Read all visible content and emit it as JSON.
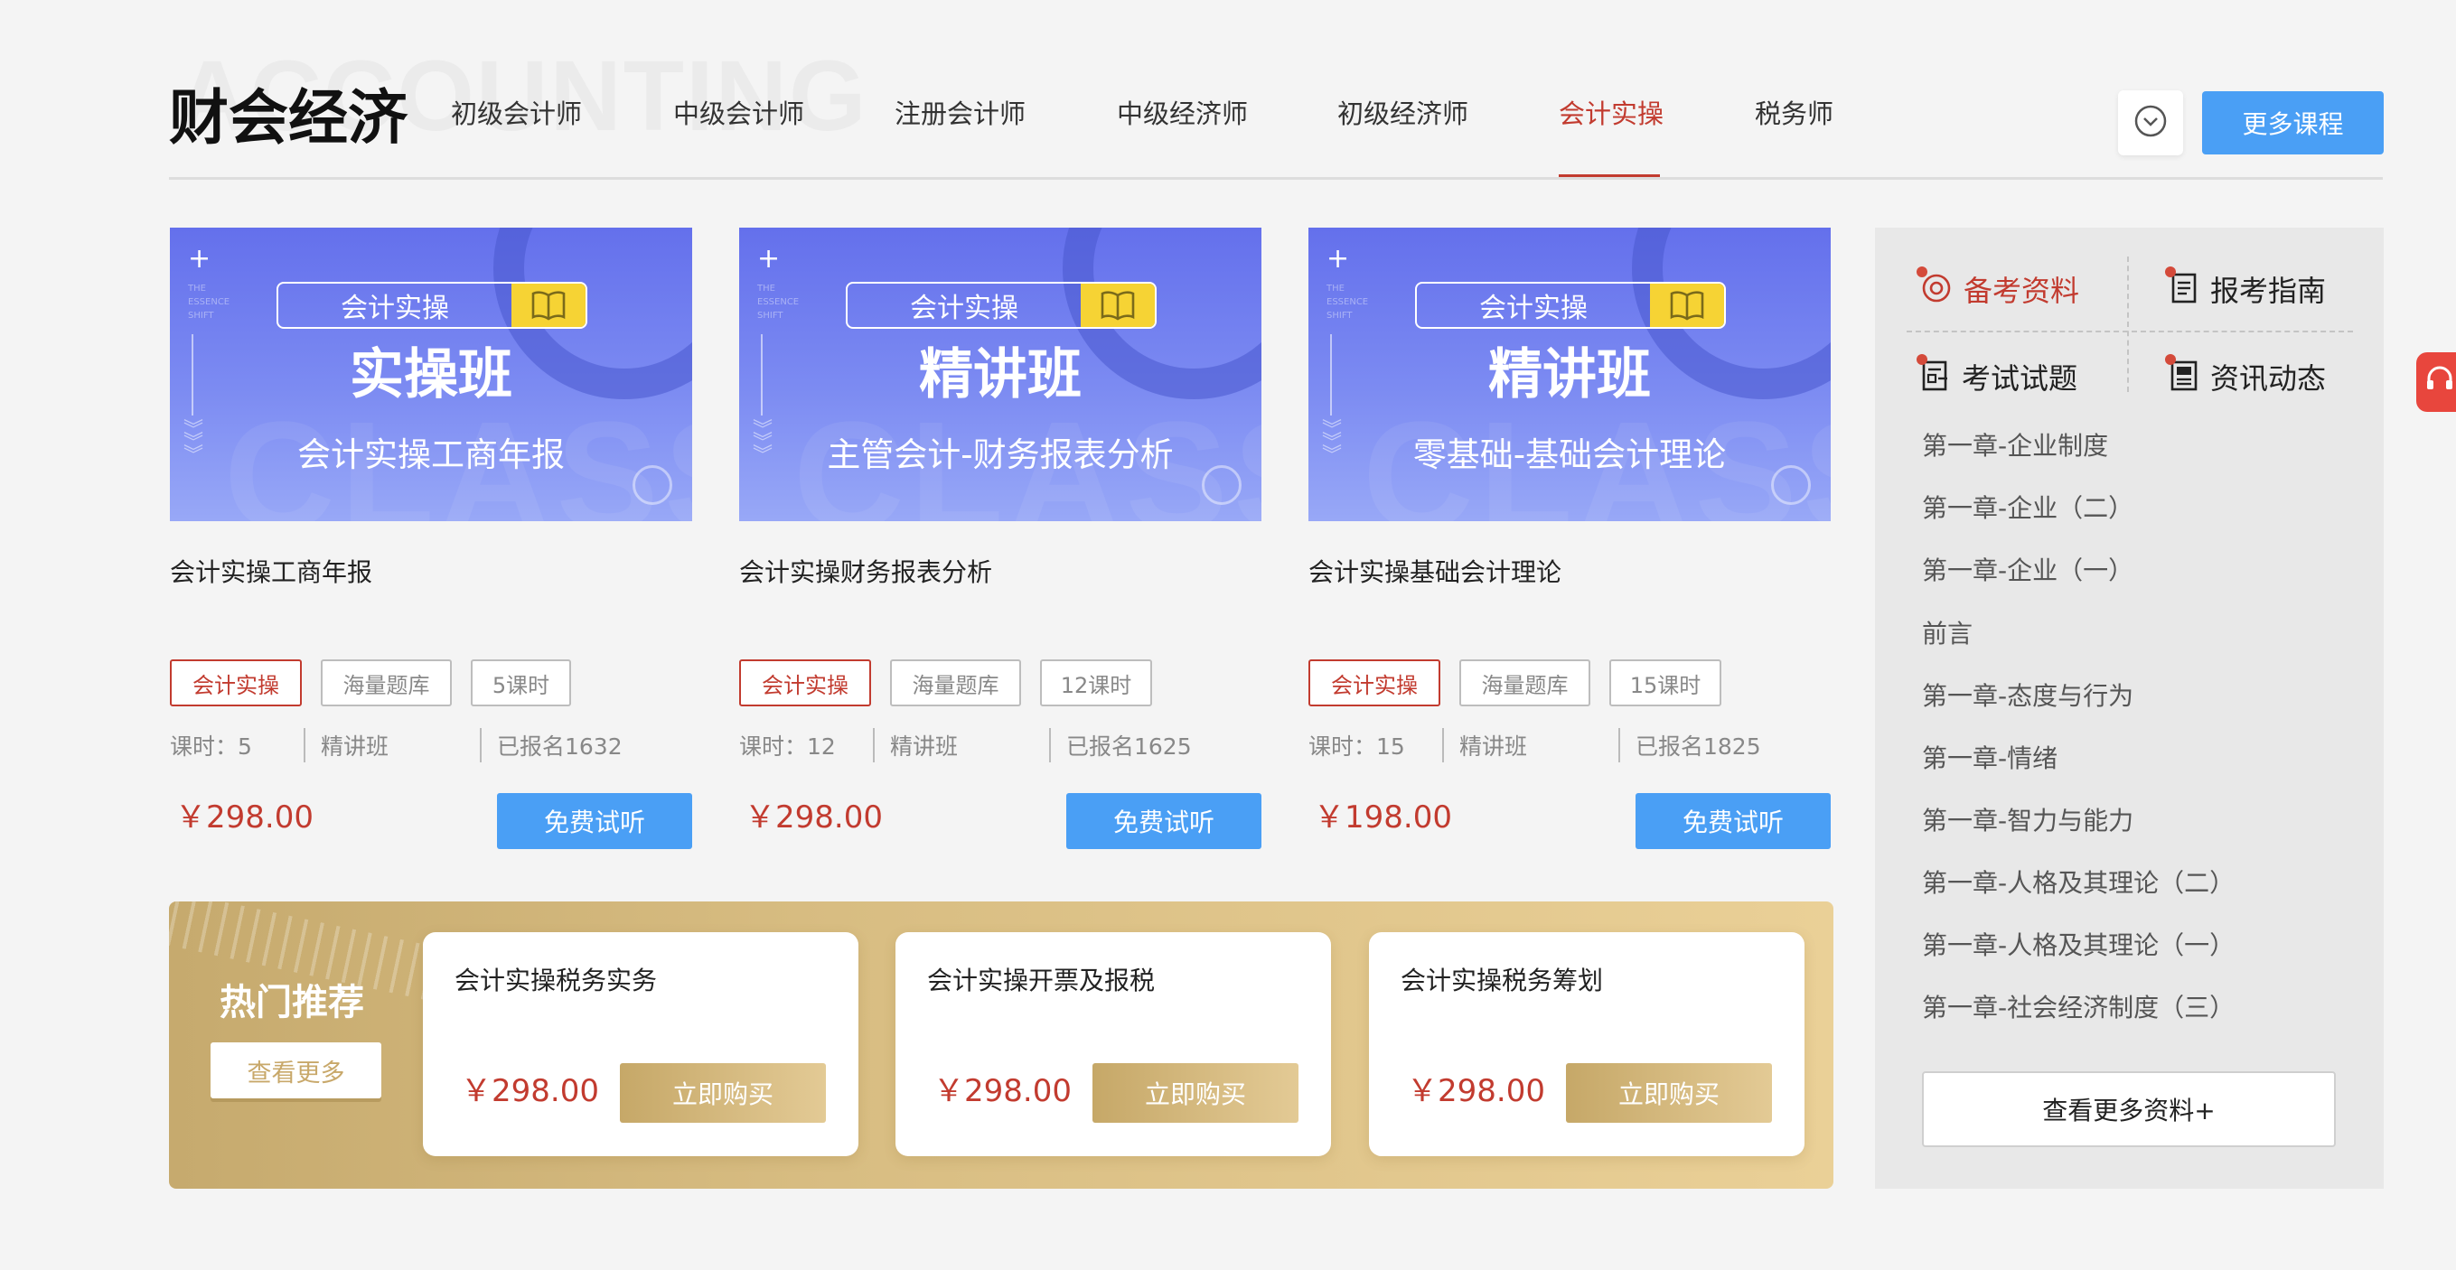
{
  "header": {
    "bg_word": "ACCOUNTING",
    "title": "财会经济",
    "tabs": [
      "初级会计师",
      "中级会计师",
      "注册会计师",
      "中级经济师",
      "初级经济师",
      "会计实操",
      "税务师"
    ],
    "active_tab": "会计实操",
    "more_courses_label": "更多课程"
  },
  "courses": [
    {
      "banner_tag": "会计实操",
      "banner_title": "实操班",
      "banner_subtitle": "会计实操工商年报",
      "name": "会计实操工商年报",
      "tags": [
        "会计实操",
        "海量题库",
        "5课时"
      ],
      "hours": "课时：5",
      "class_type": "精讲班",
      "enrolled": "已报名1632",
      "price": "￥298.00",
      "trial_label": "免费试听"
    },
    {
      "banner_tag": "会计实操",
      "banner_title": "精讲班",
      "banner_subtitle": "主管会计-财务报表分析",
      "name": "会计实操财务报表分析",
      "tags": [
        "会计实操",
        "海量题库",
        "12课时"
      ],
      "hours": "课时：12",
      "class_type": "精讲班",
      "enrolled": "已报名1625",
      "price": "￥298.00",
      "trial_label": "免费试听"
    },
    {
      "banner_tag": "会计实操",
      "banner_title": "精讲班",
      "banner_subtitle": "零基础-基础会计理论",
      "name": "会计实操基础会计理论",
      "tags": [
        "会计实操",
        "海量题库",
        "15课时"
      ],
      "hours": "课时：15",
      "class_type": "精讲班",
      "enrolled": "已报名1825",
      "price": "￥198.00",
      "trial_label": "免费试听"
    }
  ],
  "hot": {
    "title": "热门推荐",
    "more_label": "查看更多",
    "items": [
      {
        "title": "会计实操税务实务",
        "price": "￥298.00",
        "buy_label": "立即购买"
      },
      {
        "title": "会计实操开票及报税",
        "price": "￥298.00",
        "buy_label": "立即购买"
      },
      {
        "title": "会计实操税务筹划",
        "price": "￥298.00",
        "buy_label": "立即购买"
      }
    ]
  },
  "sidebar": {
    "tabs": [
      "备考资料",
      "报考指南",
      "考试试题",
      "资讯动态"
    ],
    "active_tab": "备考资料",
    "items": [
      "第一章-企业制度",
      "第一章-企业（二）",
      "第一章-企业（一）",
      "前言",
      "第一章-态度与行为",
      "第一章-情绪",
      "第一章-智力与能力",
      "第一章-人格及其理论（二）",
      "第一章-人格及其理论（一）",
      "第一章-社会经济制度（三）"
    ],
    "more_label": "查看更多资料+"
  },
  "colors": {
    "accent_red": "#c23b2f",
    "button_blue": "#4a9ff5",
    "banner_purple": "#6470ec",
    "gold": "#d8bd82"
  },
  "icons": {
    "dropdown": "chevron-down-circle-icon",
    "banner_book": "open-book-icon",
    "sidebar": [
      "target-icon",
      "document-list-icon",
      "exam-paper-icon",
      "news-icon"
    ],
    "float": "headset-icon"
  }
}
